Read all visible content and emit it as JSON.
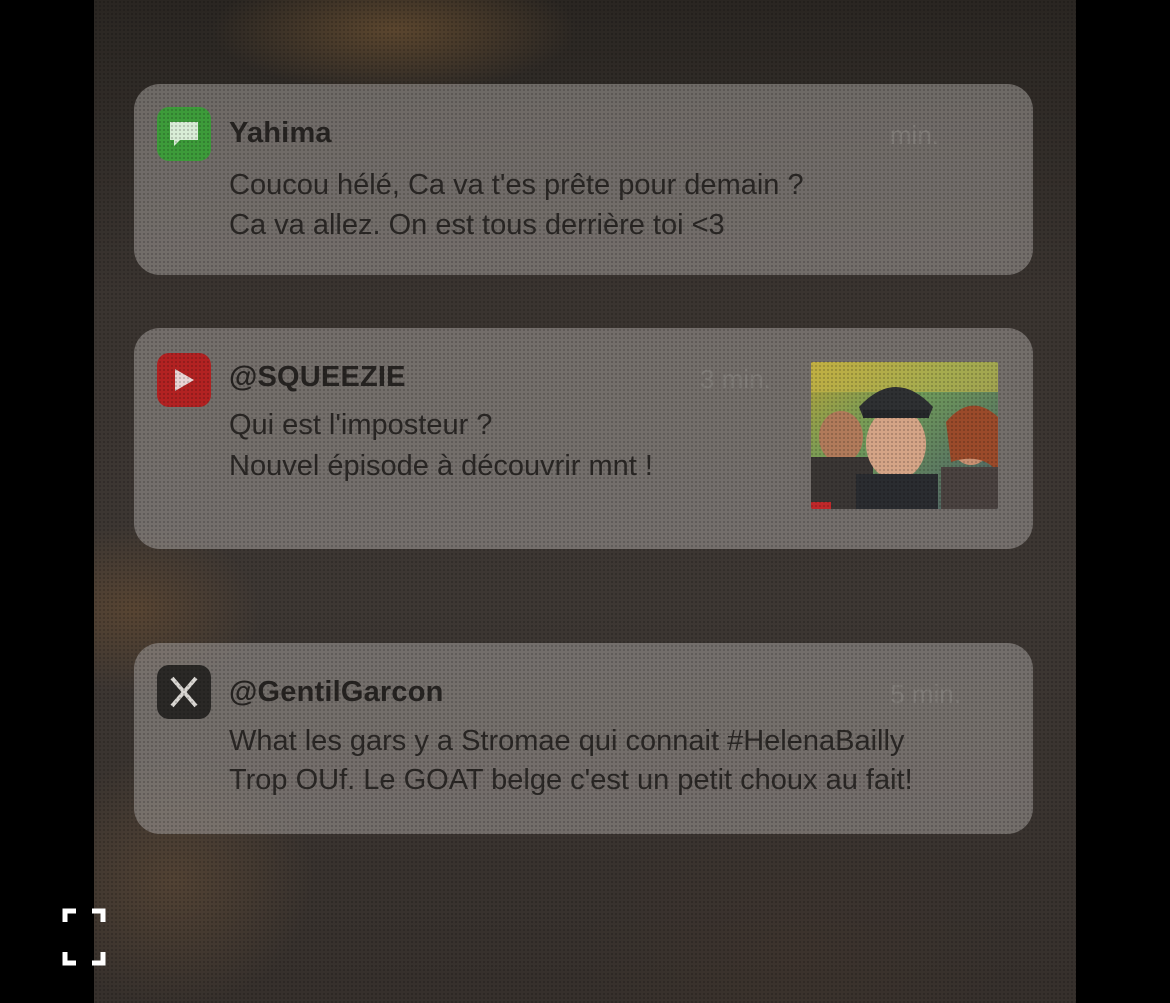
{
  "notifications": [
    {
      "app": "messages",
      "icon": "messages-icon",
      "sender": "Yahima",
      "time": "min.",
      "line1": "Coucou hélé, Ca va t'es prête pour demain ?",
      "line2": "Ca va allez. On est tous derrière toi <3"
    },
    {
      "app": "youtube",
      "icon": "youtube-icon",
      "sender": "@SQUEEZIE",
      "time": "3 min.",
      "line1": "Qui est l'imposteur ?",
      "line2": "Nouvel épisode à découvrir mnt !",
      "thumbnail": "video-thumbnail"
    },
    {
      "app": "x",
      "icon": "x-icon",
      "sender": "@GentilGarcon",
      "time": "5 min.",
      "line1": "What les gars y a Stromae qui connait #HelenaBailly",
      "line2": "Trop OUf. Le GOAT belge c'est un petit choux au fait!"
    }
  ],
  "colors": {
    "messages": "#3d9b3a",
    "youtube": "#b22222",
    "x": "#2a2826"
  },
  "overlay_icon": "fullscreen-expand-icon"
}
